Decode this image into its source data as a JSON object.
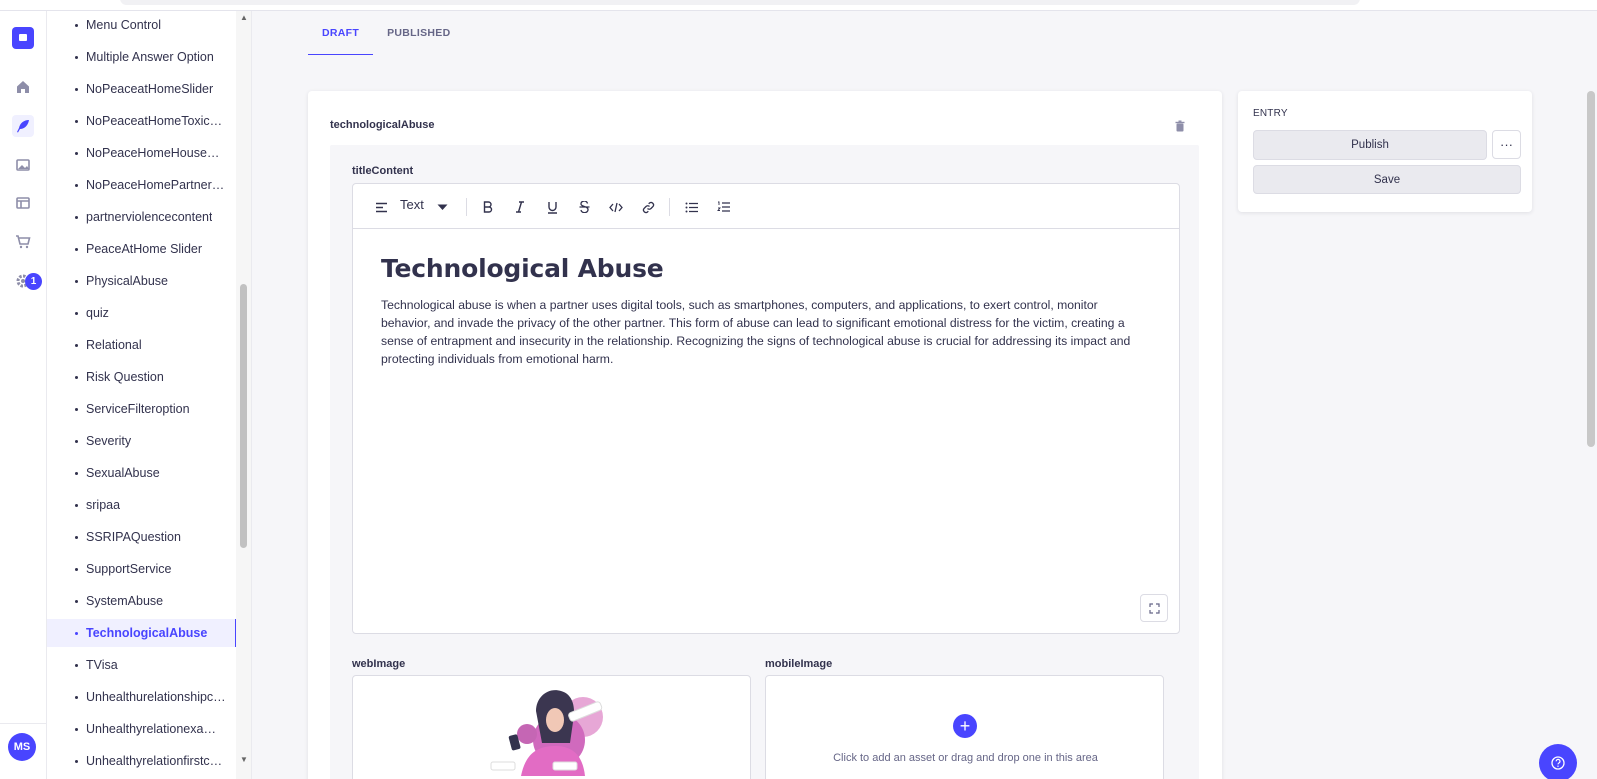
{
  "nav": {
    "notification_count": "1",
    "user_initials": "MS",
    "icons": [
      "home-icon",
      "feather-icon",
      "images-icon",
      "layout-icon",
      "cart-icon",
      "gear-icon"
    ]
  },
  "sidebar": {
    "items": [
      {
        "label": "Menu Control"
      },
      {
        "label": "Multiple Answer Option"
      },
      {
        "label": "NoPeaceatHomeSlider"
      },
      {
        "label": "NoPeaceatHomeToxicRela..."
      },
      {
        "label": "NoPeaceHomeHouseCon..."
      },
      {
        "label": "NoPeaceHomePartnerviol..."
      },
      {
        "label": "partnerviolencecontent"
      },
      {
        "label": "PeaceAtHome Slider"
      },
      {
        "label": "PhysicalAbuse"
      },
      {
        "label": "quiz"
      },
      {
        "label": "Relational"
      },
      {
        "label": "Risk Question"
      },
      {
        "label": "ServiceFilteroption"
      },
      {
        "label": "Severity"
      },
      {
        "label": "SexualAbuse"
      },
      {
        "label": "sripaa"
      },
      {
        "label": "SSRIPAQuestion"
      },
      {
        "label": "SupportService"
      },
      {
        "label": "SystemAbuse"
      },
      {
        "label": "TechnologicalAbuse",
        "active": true
      },
      {
        "label": "TVisa"
      },
      {
        "label": "Unhealthurelationshipcon..."
      },
      {
        "label": "Unhealthyrelationexample"
      },
      {
        "label": "Unhealthyrelationfirstcon..."
      }
    ]
  },
  "tabs": [
    {
      "label": "DRAFT",
      "active": true
    },
    {
      "label": "PUBLISHED"
    }
  ],
  "component": {
    "name": "technologicalAbuse",
    "title_content_label": "titleContent",
    "editor": {
      "block_type": "Text",
      "heading": "Technological Abuse",
      "paragraph": "Technological abuse is when a partner uses digital tools, such as smartphones, computers, and applications, to exert control, monitor behavior, and invade the privacy of the other partner. This form of abuse can lead to significant emotional distress for the victim, creating a sense of entrapment and insecurity in the relationship. Recognizing the signs of technological abuse is crucial for addressing its impact and protecting individuals from emotional harm."
    },
    "web_image_label": "webImage",
    "mobile_image_label": "mobileImage",
    "drop_hint": "Click to add an asset or drag and drop one in this area"
  },
  "entry_panel": {
    "title": "ENTRY",
    "publish_label": "Publish",
    "save_label": "Save",
    "more_label": "···"
  },
  "colors": {
    "primary": "#4945ff",
    "text": "#32324d",
    "background": "#f6f6f9"
  }
}
